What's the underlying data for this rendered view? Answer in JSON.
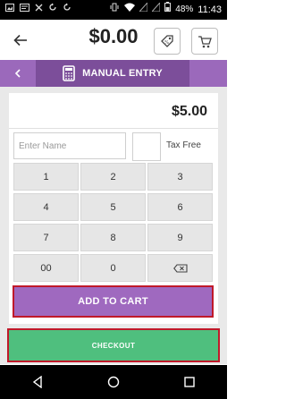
{
  "status_bar": {
    "left_icons": [
      "photo-icon",
      "notification-icon",
      "mute-icon",
      "sync-icon",
      "sync-icon"
    ],
    "right_icons": [
      "vibrate-icon",
      "wifi-icon",
      "signal-off-icon",
      "signal-off-icon",
      "battery-icon"
    ],
    "battery_percent": "48%",
    "time": "11:43"
  },
  "app_bar": {
    "back_icon": "arrow-left-icon",
    "total": "$0.00",
    "tag_icon": "tag-icon",
    "cart_icon": "cart-icon"
  },
  "header": {
    "back_icon": "chevron-left-icon",
    "tab_icon": "calculator-icon",
    "tab_label": "MANUAL ENTRY"
  },
  "entry": {
    "amount": "$5.00",
    "name_placeholder": "Enter Name",
    "name_value": "",
    "tax_free_label": "Tax Free",
    "tax_free_checked": false
  },
  "keypad": {
    "keys": [
      "1",
      "2",
      "3",
      "4",
      "5",
      "6",
      "7",
      "8",
      "9",
      "00",
      "0",
      ""
    ],
    "backspace_icon": "backspace-icon"
  },
  "actions": {
    "add_to_cart_label": "ADD TO CART",
    "checkout_label": "CHECKOUT"
  },
  "nav_bar": {
    "back_icon": "triangle-back-icon",
    "home_icon": "circle-home-icon",
    "recents_icon": "square-recents-icon"
  },
  "colors": {
    "purple": "#9b69bb",
    "purple_dark": "#7c4e9a",
    "green": "#4fbf7e",
    "highlight_red": "#c0192a"
  }
}
